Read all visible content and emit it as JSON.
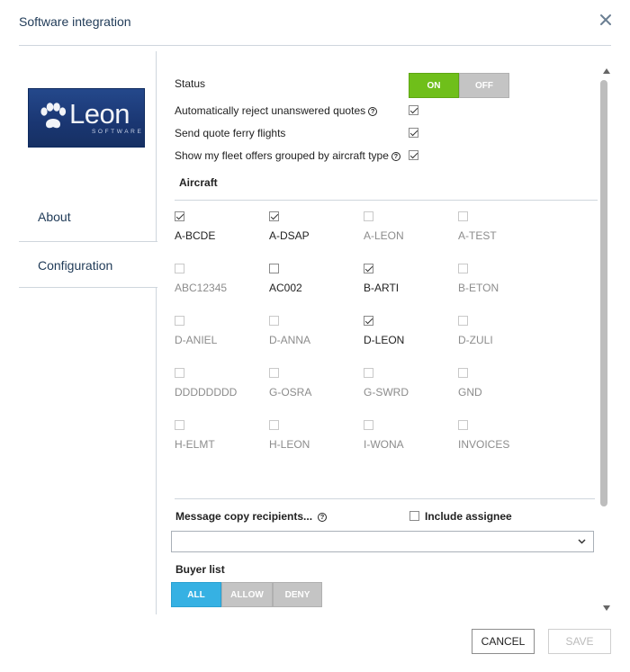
{
  "header": {
    "title": "Software integration",
    "close_icon": "close-icon"
  },
  "sidebar": {
    "logo": {
      "word": "Leon",
      "sub": "SOFTWARE"
    },
    "items": [
      {
        "label": "About"
      },
      {
        "label": "Configuration"
      }
    ]
  },
  "config": {
    "status_label": "Status",
    "status_on": "ON",
    "status_off": "OFF",
    "reject_label": "Automatically reject unanswered quotes",
    "ferry_label": "Send quote ferry flights",
    "fleet_label": "Show my fleet offers grouped by aircraft type",
    "help_glyph": "?",
    "aircraft_title": "Aircraft",
    "aircraft": [
      {
        "label": "A-BCDE",
        "checked": true
      },
      {
        "label": "A-DSAP",
        "checked": true
      },
      {
        "label": "A-LEON",
        "checked": false
      },
      {
        "label": "A-TEST",
        "checked": false
      },
      {
        "label": "ABC12345",
        "checked": false
      },
      {
        "label": "AC002",
        "checked": false
      },
      {
        "label": "B-ARTI",
        "checked": true
      },
      {
        "label": "B-ETON",
        "checked": false
      },
      {
        "label": "D-ANIEL",
        "checked": false
      },
      {
        "label": "D-ANNA",
        "checked": false
      },
      {
        "label": "D-LEON",
        "checked": true
      },
      {
        "label": "D-ZULI",
        "checked": false
      },
      {
        "label": "DDDDDDDD",
        "checked": false
      },
      {
        "label": "G-OSRA",
        "checked": false
      },
      {
        "label": "G-SWRD",
        "checked": false
      },
      {
        "label": "GND",
        "checked": false
      },
      {
        "label": "H-ELMT",
        "checked": false
      },
      {
        "label": "H-LEON",
        "checked": false
      },
      {
        "label": "I-WONA",
        "checked": false
      },
      {
        "label": "INVOICES",
        "checked": false
      }
    ],
    "recipients_label": "Message copy recipients...",
    "include_assignee_label": "Include assignee",
    "buyer_list_label": "Buyer list",
    "buyer_all": "ALL",
    "buyer_allow": "ALLOW",
    "buyer_deny": "DENY"
  },
  "footer": {
    "cancel": "CANCEL",
    "save": "SAVE"
  },
  "colors": {
    "on": "#6fbf1a",
    "off": "#c4c4c4",
    "all": "#36b1e3",
    "title": "#1f3a57"
  }
}
